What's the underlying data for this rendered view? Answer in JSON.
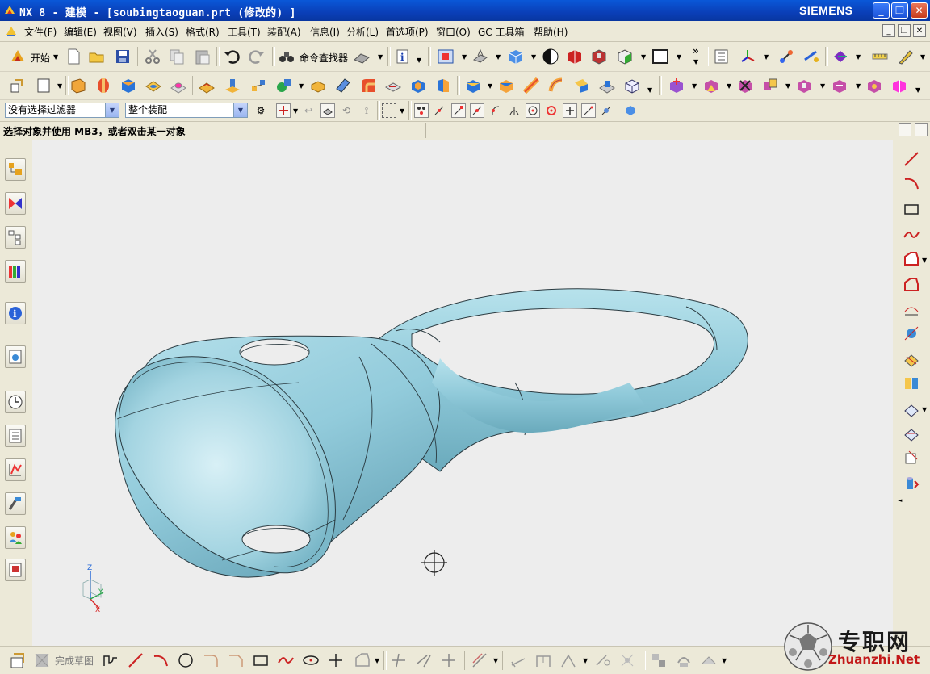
{
  "window": {
    "title": "NX 8 - 建模 - [soubingtaoguan.prt  (修改的) ]",
    "brand": "SIEMENS",
    "controls": [
      "_",
      "❐",
      "✕"
    ]
  },
  "menu": {
    "items": [
      "文件(F)",
      "编辑(E)",
      "视图(V)",
      "插入(S)",
      "格式(R)",
      "工具(T)",
      "装配(A)",
      "信息(I)",
      "分析(L)",
      "首选项(P)",
      "窗口(O)",
      "GC 工具箱",
      "帮助(H)"
    ]
  },
  "toolbar1": {
    "start_label": "开始",
    "command_finder_label": "命令查找器",
    "more": "»"
  },
  "selection_bar": {
    "filter_value": "没有选择过滤器",
    "scope_value": "整个装配"
  },
  "cue": {
    "text": "选择对象并使用 MB3，或者双击某一对象"
  },
  "triad": {
    "z": "Z",
    "y": "Y",
    "x": "X"
  },
  "sketch_bar": {
    "finish_label": "完成草图"
  },
  "watermark": {
    "cn": "专职网",
    "en": "Zhuanzhi.Net"
  },
  "colors": {
    "model": "#8fc9d9",
    "viewport_bg": "#ededed",
    "titlebar": "#0a4fd0"
  }
}
